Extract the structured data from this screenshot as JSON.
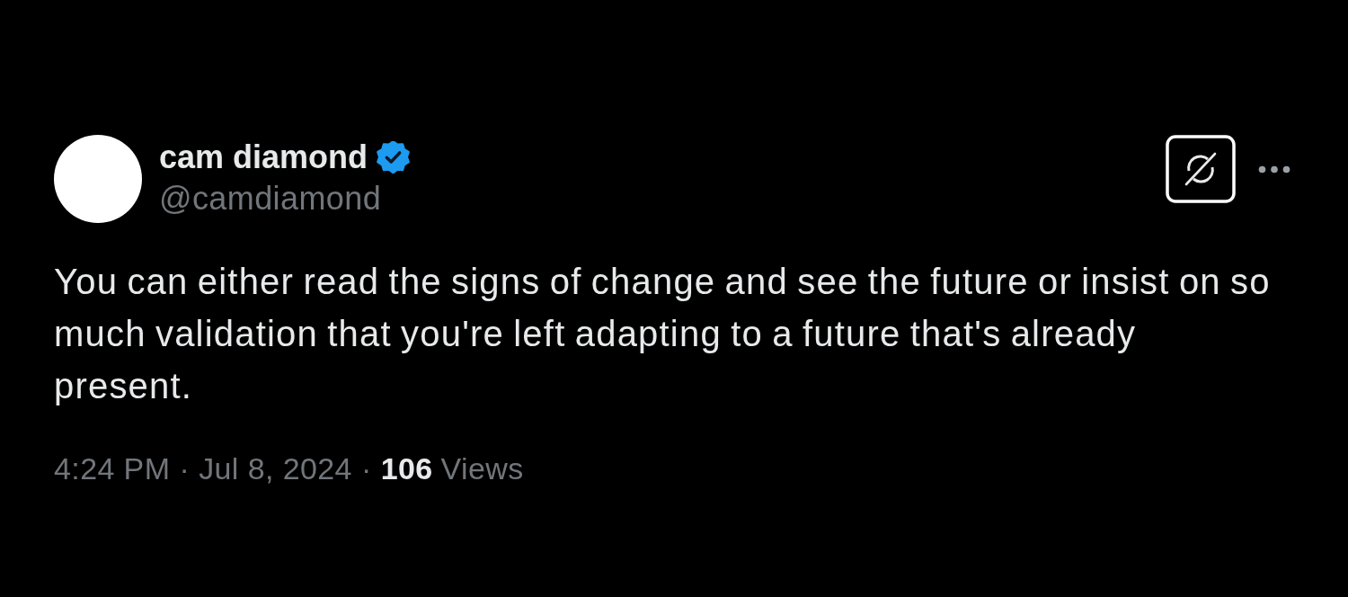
{
  "author": {
    "name": "cam diamond",
    "verified": true,
    "handle": "@camdiamond"
  },
  "tweet": {
    "text": "You can either read the signs of change and see the future or insist on so much validation that you're left adapting to a future that's already present."
  },
  "meta": [
    {
      "kind": "time",
      "text": "4:24 PM"
    },
    {
      "kind": "separator",
      "text": "·"
    },
    {
      "kind": "date",
      "text": "Jul 8, 2024"
    },
    {
      "kind": "separator",
      "text": "·"
    },
    {
      "kind": "count",
      "text": "106"
    },
    {
      "kind": "label",
      "text": "Views"
    }
  ]
}
